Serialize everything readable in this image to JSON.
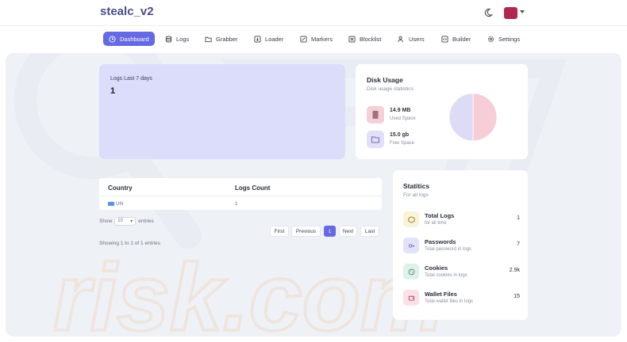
{
  "app": {
    "title": "stealc_v2"
  },
  "nav": {
    "items": [
      {
        "label": "Dashboard",
        "icon": "clock-icon"
      },
      {
        "label": "Logs",
        "icon": "database-icon"
      },
      {
        "label": "Grabber",
        "icon": "folder-icon"
      },
      {
        "label": "Loader",
        "icon": "download-icon"
      },
      {
        "label": "Markers",
        "icon": "edit-icon"
      },
      {
        "label": "Blocklist",
        "icon": "block-icon"
      },
      {
        "label": "Users",
        "icon": "users-icon"
      },
      {
        "label": "Builder",
        "icon": "code-icon"
      },
      {
        "label": "Settings",
        "icon": "gear-icon"
      }
    ],
    "active": "Dashboard"
  },
  "logs_card": {
    "label": "Logs Last 7 days",
    "value": "1"
  },
  "disk": {
    "title": "Disk Usage",
    "subtitle": "Disk usage statistics",
    "used": {
      "value": "14.9 MB",
      "label": "Used Space"
    },
    "free": {
      "value": "15.0 gb",
      "label": "Free Space"
    }
  },
  "chart_data": {
    "type": "pie",
    "categories": [
      "Used Space",
      "Free Space"
    ],
    "values": [
      50,
      50
    ],
    "colors": [
      "#f7cdd8",
      "#dcdcf7"
    ]
  },
  "table": {
    "headers": [
      "Country",
      "Logs Count"
    ],
    "rows": [
      {
        "country": "UN",
        "count": "1"
      }
    ],
    "show_label": "Show",
    "entries_value": "10",
    "entries_label": "entries",
    "info": "Showing 1 to 1 of 1 entries"
  },
  "pagination": {
    "first": "First",
    "previous": "Previous",
    "current": "1",
    "next": "Next",
    "last": "Last"
  },
  "stats": {
    "title": "Statitics",
    "subtitle": "For all logs",
    "items": [
      {
        "name": "Total Logs",
        "desc": "for all time",
        "count": "1",
        "color": "#fbf3d6",
        "icon": "box-icon"
      },
      {
        "name": "Passwords",
        "desc": "Total password in logs",
        "count": "7",
        "color": "#e3e2fb",
        "icon": "key-icon"
      },
      {
        "name": "Cookies",
        "desc": "Total cookies in logs",
        "count": "2.9k",
        "color": "#dff2ea",
        "icon": "cookie-icon"
      },
      {
        "name": "Wallet Files",
        "desc": "Total wallet files in logs",
        "count": "15",
        "color": "#fbe0e7",
        "icon": "wallet-icon"
      }
    ]
  },
  "colors": {
    "accent": "#6569e4",
    "brand": "#4a4e8c",
    "logs_card_bg": "#dcdcfb"
  }
}
